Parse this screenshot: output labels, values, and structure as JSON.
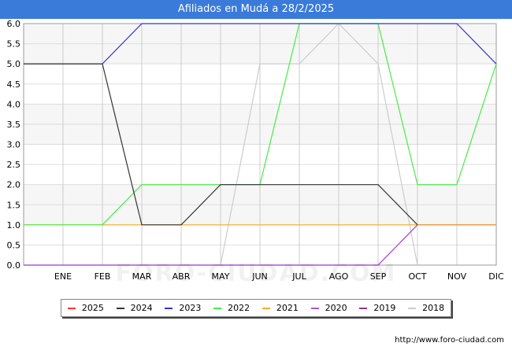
{
  "header": {
    "title": "Afiliados en Mudá a 28/2/2025"
  },
  "watermark": "FORO-CIUDAD.COM",
  "source": "http://www.foro-ciudad.com",
  "chart_data": {
    "type": "line",
    "title": "Afiliados en Mudá a 28/2/2025",
    "xlabel": "",
    "ylabel": "",
    "ylim": [
      0,
      6
    ],
    "yticks": [
      "0.0",
      "0.5",
      "1.0",
      "1.5",
      "2.0",
      "2.5",
      "3.0",
      "3.5",
      "4.0",
      "4.5",
      "5.0",
      "5.5",
      "6.0"
    ],
    "categories": [
      "ENE",
      "FEB",
      "MAR",
      "ABR",
      "MAY",
      "JUN",
      "JUL",
      "AGO",
      "SEP",
      "OCT",
      "NOV",
      "DIC"
    ],
    "grid": true,
    "legend_position": "bottom",
    "series": [
      {
        "name": "2018",
        "color": "#cccccc",
        "values": [
          null,
          null,
          null,
          null,
          0,
          5,
          5,
          6,
          5,
          0,
          null,
          null
        ]
      },
      {
        "name": "2019",
        "color": "#993388",
        "values": [
          0,
          0,
          0,
          0,
          0,
          0,
          0,
          0,
          0,
          1,
          1,
          1
        ],
        "start": 0
      },
      {
        "name": "2020",
        "color": "#aa55dd",
        "values": [
          0,
          0,
          0,
          0,
          0,
          0,
          0,
          0,
          0,
          1,
          1,
          1
        ],
        "start": 0
      },
      {
        "name": "2021",
        "color": "#ffaa22",
        "values": [
          1,
          1,
          1,
          1,
          1,
          1,
          1,
          1,
          1,
          1,
          1,
          1
        ],
        "start": 1
      },
      {
        "name": "2022",
        "color": "#44ee44",
        "values": [
          1,
          1,
          2,
          2,
          2,
          2,
          6,
          6,
          6,
          2,
          2,
          5
        ],
        "start": 1
      },
      {
        "name": "2023",
        "color": "#3333cc",
        "values": [
          5,
          5,
          6,
          6,
          6,
          6,
          6,
          6,
          6,
          6,
          6,
          5
        ],
        "start": 5
      },
      {
        "name": "2024",
        "color": "#333333",
        "values": [
          5,
          5,
          1,
          1,
          2,
          2,
          2,
          2,
          2,
          1,
          null,
          null
        ],
        "start": 5
      },
      {
        "name": "2025",
        "color": "#ff3333",
        "values": [
          null,
          null,
          null,
          null,
          null,
          null,
          null,
          null,
          null,
          null,
          null,
          null
        ]
      }
    ],
    "legend_order": [
      "2025",
      "2024",
      "2023",
      "2022",
      "2021",
      "2020",
      "2019",
      "2018"
    ]
  }
}
